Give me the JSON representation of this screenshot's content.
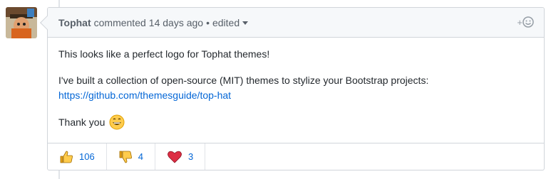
{
  "comment": {
    "author": "Tophat",
    "action": "commented",
    "time": "14 days ago",
    "separator": "•",
    "edited_label": "edited",
    "reaction_picker": "+",
    "body": {
      "line1": "This looks like a perfect logo for Tophat themes!",
      "line2": "I've built a collection of open-source (MIT) themes to stylize your Bootstrap projects:",
      "link": "https://github.com/themesguide/top-hat",
      "thanks": "Thank you"
    },
    "reactions": [
      {
        "icon": "thumbs-up-icon",
        "count": "106"
      },
      {
        "icon": "thumbs-down-icon",
        "count": "4"
      },
      {
        "icon": "heart-icon",
        "count": "3"
      }
    ]
  },
  "colors": {
    "link": "#0366d6",
    "header_bg": "#f6f8fa",
    "border": "#d1d5da"
  }
}
